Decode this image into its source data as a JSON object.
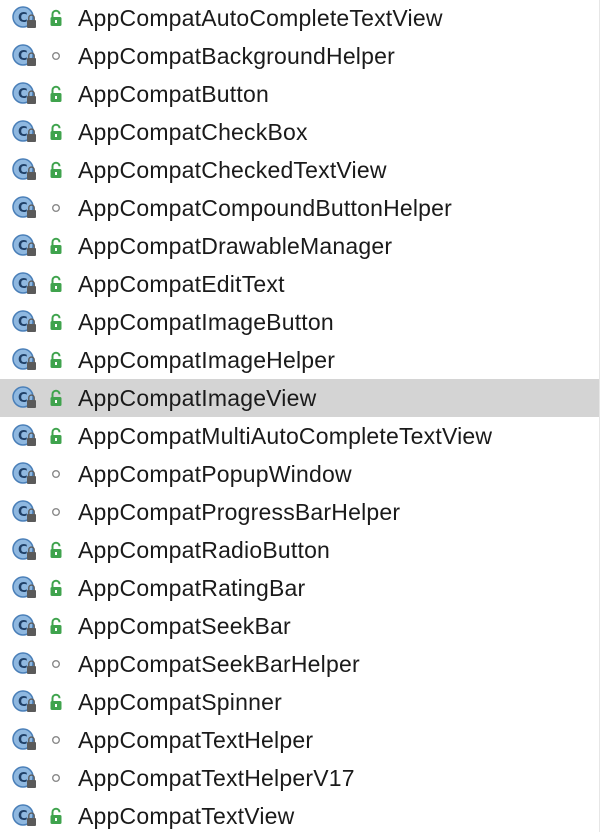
{
  "colors": {
    "selected_row": "#d4d4d4",
    "class_icon_fill": "#8fb8e0",
    "class_icon_border": "#4a7fb8",
    "public_lock": "#3fa34d",
    "package_private_dot": "#8a8a8a"
  },
  "items": [
    {
      "label": "AppCompatAutoCompleteTextView",
      "visibility": "public",
      "icon": "class-icon"
    },
    {
      "label": "AppCompatBackgroundHelper",
      "visibility": "package-private",
      "icon": "class-icon"
    },
    {
      "label": "AppCompatButton",
      "visibility": "public",
      "icon": "class-icon"
    },
    {
      "label": "AppCompatCheckBox",
      "visibility": "public",
      "icon": "class-icon"
    },
    {
      "label": "AppCompatCheckedTextView",
      "visibility": "public",
      "icon": "class-icon"
    },
    {
      "label": "AppCompatCompoundButtonHelper",
      "visibility": "package-private",
      "icon": "class-icon"
    },
    {
      "label": "AppCompatDrawableManager",
      "visibility": "public",
      "icon": "class-icon"
    },
    {
      "label": "AppCompatEditText",
      "visibility": "public",
      "icon": "class-icon"
    },
    {
      "label": "AppCompatImageButton",
      "visibility": "public",
      "icon": "class-icon"
    },
    {
      "label": "AppCompatImageHelper",
      "visibility": "public",
      "icon": "class-icon"
    },
    {
      "label": "AppCompatImageView",
      "visibility": "public",
      "icon": "class-icon",
      "selected": true
    },
    {
      "label": "AppCompatMultiAutoCompleteTextView",
      "visibility": "public",
      "icon": "class-icon"
    },
    {
      "label": "AppCompatPopupWindow",
      "visibility": "package-private",
      "icon": "class-icon"
    },
    {
      "label": "AppCompatProgressBarHelper",
      "visibility": "package-private",
      "icon": "class-icon"
    },
    {
      "label": "AppCompatRadioButton",
      "visibility": "public",
      "icon": "class-icon"
    },
    {
      "label": "AppCompatRatingBar",
      "visibility": "public",
      "icon": "class-icon"
    },
    {
      "label": "AppCompatSeekBar",
      "visibility": "public",
      "icon": "class-icon"
    },
    {
      "label": "AppCompatSeekBarHelper",
      "visibility": "package-private",
      "icon": "class-icon"
    },
    {
      "label": "AppCompatSpinner",
      "visibility": "public",
      "icon": "class-icon"
    },
    {
      "label": "AppCompatTextHelper",
      "visibility": "package-private",
      "icon": "class-icon"
    },
    {
      "label": "AppCompatTextHelperV17",
      "visibility": "package-private",
      "icon": "class-icon"
    },
    {
      "label": "AppCompatTextView",
      "visibility": "public",
      "icon": "class-icon"
    }
  ]
}
